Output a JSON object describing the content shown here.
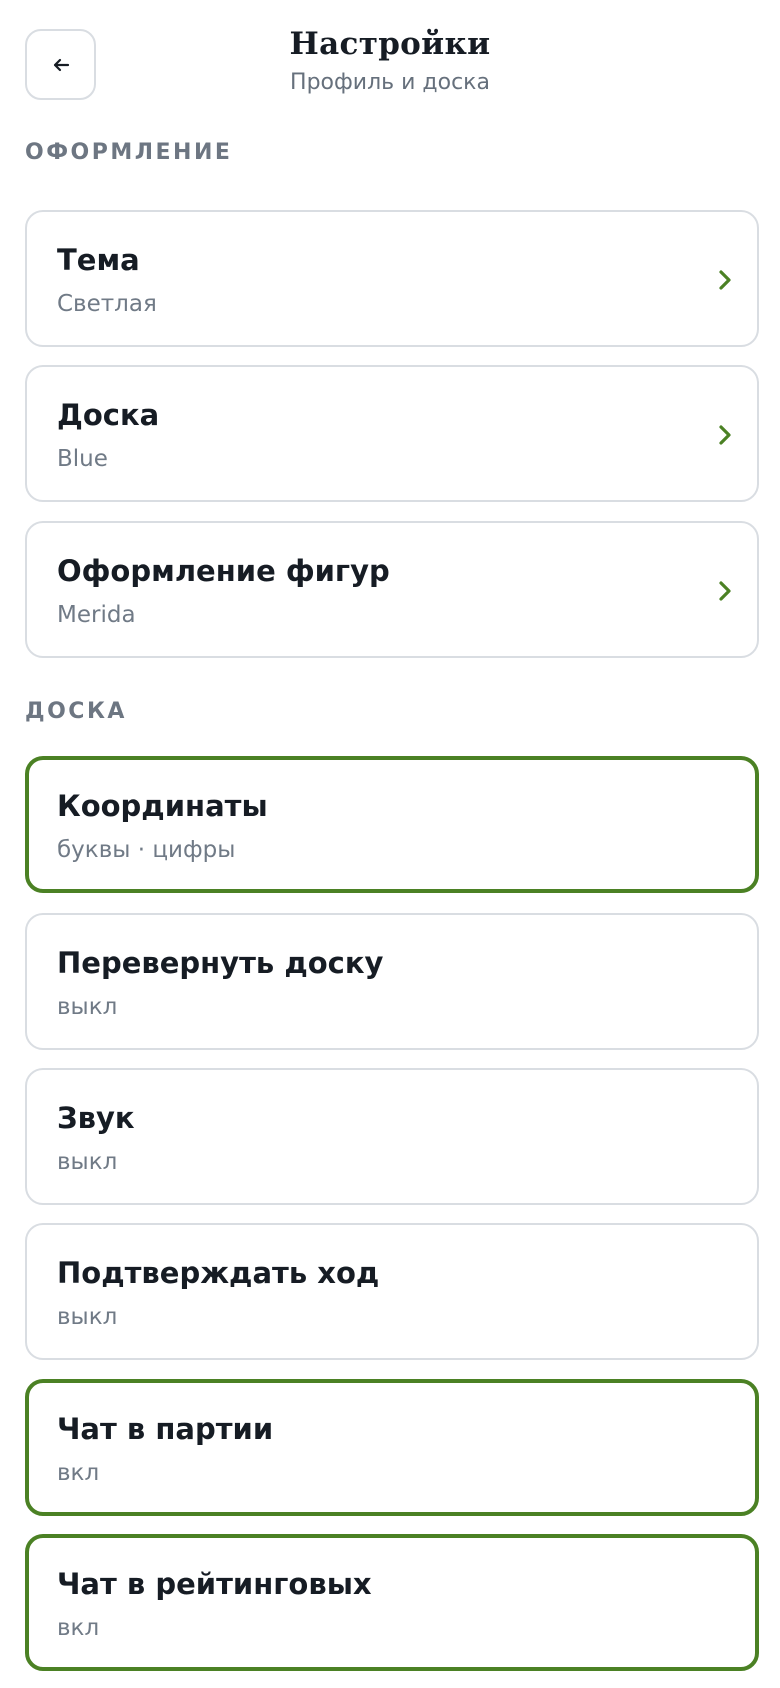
{
  "header": {
    "back_icon": "arrow-left-icon",
    "title": "Настройки",
    "subtitle": "Профиль и доска"
  },
  "colors": {
    "accent": "#4b8124",
    "border": "#d9dde2",
    "text": "#161c24",
    "muted": "#707a86"
  },
  "sections": [
    {
      "label": "ОФОРМЛЕНИЕ",
      "items": [
        {
          "title": "Тема",
          "value": "Светлая",
          "chevron": true,
          "active": false
        },
        {
          "title": "Доска",
          "value": "Blue",
          "chevron": true,
          "active": false
        },
        {
          "title": "Оформление фигур",
          "value": "Merida",
          "chevron": true,
          "active": false
        }
      ]
    },
    {
      "label": "ДОСКА",
      "items": [
        {
          "title": "Координаты",
          "value": "буквы · цифры",
          "chevron": false,
          "active": true
        },
        {
          "title": "Перевернуть доску",
          "value": "выкл",
          "chevron": false,
          "active": false
        },
        {
          "title": "Звук",
          "value": "выкл",
          "chevron": false,
          "active": false
        },
        {
          "title": "Подтверждать ход",
          "value": "выкл",
          "chevron": false,
          "active": false
        },
        {
          "title": "Чат в партии",
          "value": "вкл",
          "chevron": false,
          "active": true
        },
        {
          "title": "Чат в рейтинговых",
          "value": "вкл",
          "chevron": false,
          "active": true
        }
      ]
    }
  ]
}
